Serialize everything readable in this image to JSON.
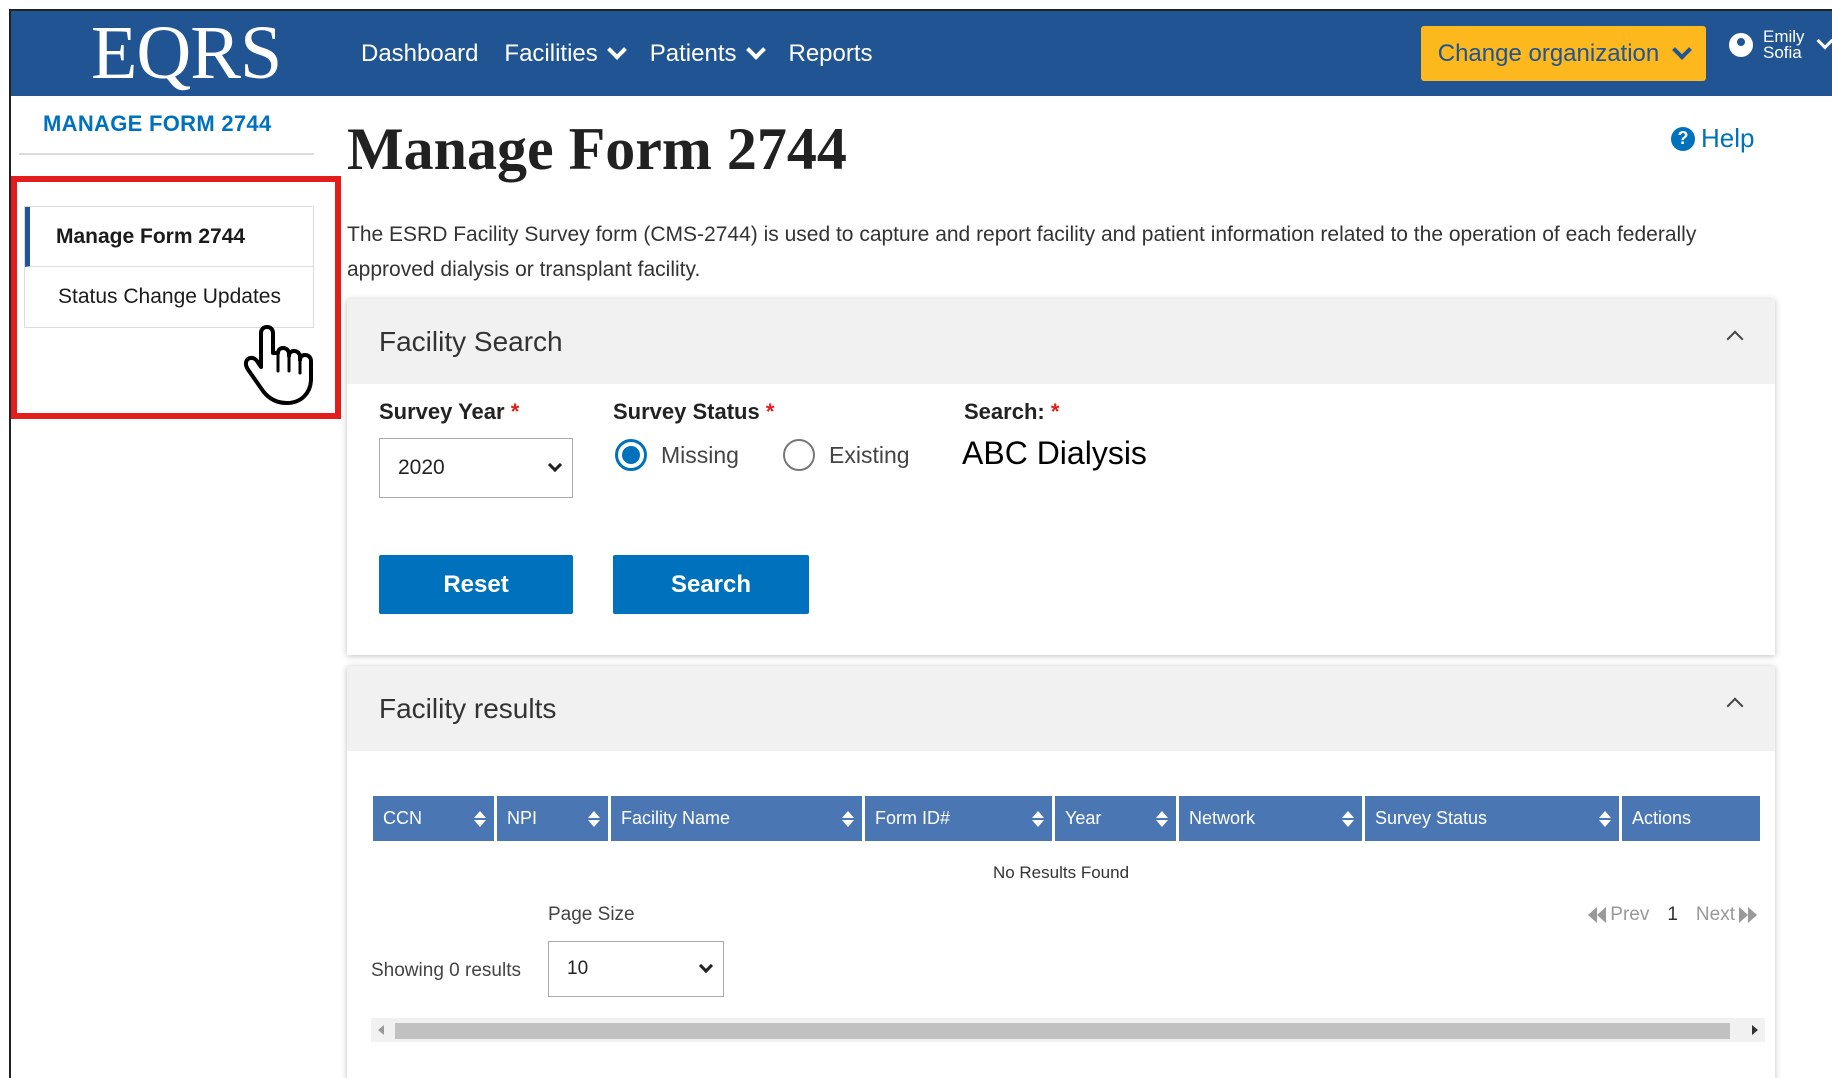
{
  "header": {
    "logo": "EQRS",
    "nav": {
      "dashboard": "Dashboard",
      "facilities": "Facilities",
      "patients": "Patients",
      "reports": "Reports"
    },
    "change_org": "Change organization",
    "user_first": "Emily",
    "user_last": "Sofia"
  },
  "sidebar": {
    "title": "MANAGE FORM 2744",
    "items": [
      {
        "label": "Manage Form 2744"
      },
      {
        "label": "Status Change Updates"
      }
    ]
  },
  "main": {
    "title": "Manage Form 2744",
    "help": "Help",
    "description": "The ESRD Facility Survey form (CMS-2744) is used to capture and report facility and patient information related to the operation of each federally approved dialysis or transplant facility."
  },
  "facility_search": {
    "heading": "Facility Search",
    "survey_year_label": "Survey Year",
    "survey_year_value": "2020",
    "survey_status_label": "Survey Status",
    "status_missing": "Missing",
    "status_existing": "Existing",
    "search_label": "Search:",
    "search_value": "ABC Dialysis",
    "required_mark": "*",
    "reset": "Reset",
    "search": "Search"
  },
  "facility_results": {
    "heading": "Facility results",
    "columns": [
      "CCN",
      "NPI",
      "Facility Name",
      "Form ID#",
      "Year",
      "Network",
      "Survey Status",
      "Actions"
    ],
    "no_results": "No Results Found",
    "page_size_label": "Page Size",
    "page_size_value": "10",
    "showing": "Showing 0 results",
    "prev": "Prev",
    "page": "1",
    "next": "Next"
  },
  "colors": {
    "header_bg": "#205493",
    "accent_button": "#fdb81e",
    "primary": "#0071bc",
    "table_header": "#4a77b4",
    "highlight": "#e31c1c"
  }
}
